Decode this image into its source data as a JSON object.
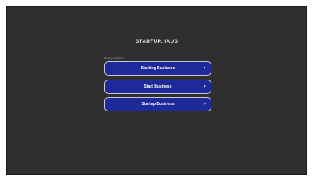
{
  "site": {
    "title": "STARTUP.HAUS"
  },
  "related": {
    "label": "Related searches",
    "items": [
      {
        "label": "Starting Business",
        "icon": "chevron-right-icon",
        "glyph": "›"
      },
      {
        "label": "Start Business",
        "icon": "chevron-right-icon",
        "glyph": "›"
      },
      {
        "label": "Startup Business",
        "icon": "chevron-right-icon",
        "glyph": "›"
      }
    ]
  },
  "colors": {
    "background": "#2f2f2f",
    "button": "#1f2a9a",
    "button_border": "#c9c9d6",
    "text": "#ffffff"
  }
}
